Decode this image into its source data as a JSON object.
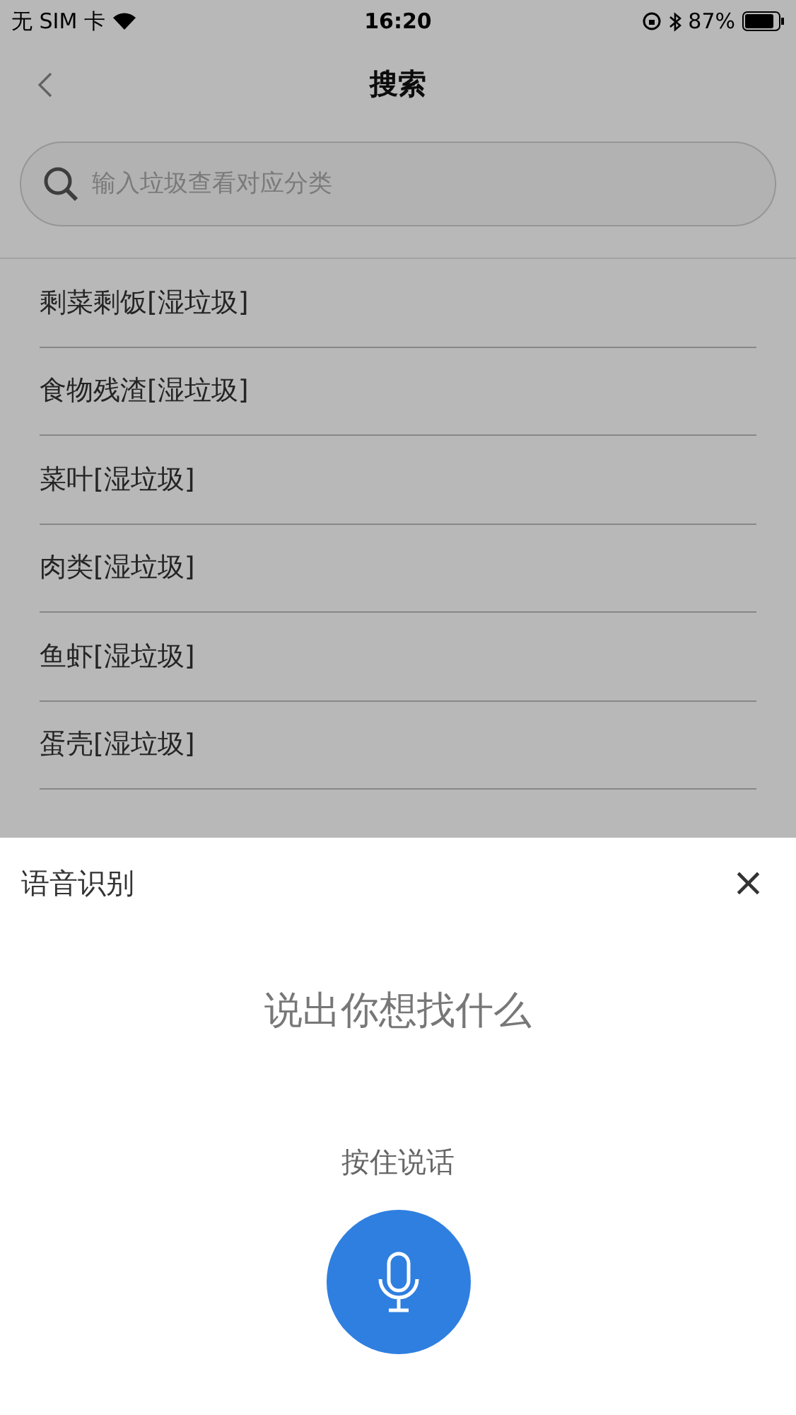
{
  "status_bar": {
    "carrier": "无 SIM 卡",
    "time": "16:20",
    "battery": "87%",
    "level": 0.87
  },
  "nav": {
    "title": "搜索"
  },
  "search": {
    "placeholder": "输入垃圾查看对应分类"
  },
  "results": [
    {
      "label": "剩菜剩饭[湿垃圾]"
    },
    {
      "label": "食物残渣[湿垃圾]"
    },
    {
      "label": "菜叶[湿垃圾]"
    },
    {
      "label": "肉类[湿垃圾]"
    },
    {
      "label": "鱼虾[湿垃圾]"
    },
    {
      "label": "蛋壳[湿垃圾]"
    }
  ],
  "voice_sheet": {
    "title": "语音识别",
    "close": "×",
    "prompt": "说出你想找什么",
    "hint": "按住说话"
  }
}
